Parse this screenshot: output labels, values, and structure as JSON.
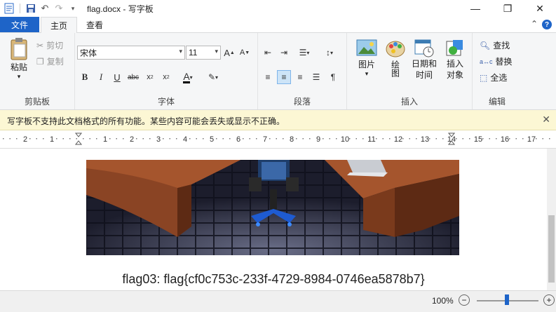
{
  "window": {
    "title": "flag.docx - 写字板"
  },
  "tabs": {
    "file": "文件",
    "home": "主页",
    "view": "查看"
  },
  "clipboard": {
    "paste": "粘贴",
    "cut": "剪切",
    "copy": "复制",
    "label": "剪贴板"
  },
  "font": {
    "name": "宋体",
    "size": "11",
    "label": "字体"
  },
  "paragraph": {
    "label": "段落"
  },
  "insert": {
    "picture": "图片",
    "paint": "绘图",
    "datetime": "日期和时间",
    "object": "插入对象",
    "label": "插入"
  },
  "editing": {
    "find": "查找",
    "replace": "替换",
    "select_all": "全选",
    "label": "编辑"
  },
  "infobar": {
    "message": "写字板不支持此文档格式的所有功能。某些内容可能会丢失或显示不正确。"
  },
  "ruler": {
    "ticks": [
      "2",
      "1",
      "1",
      "2",
      "3",
      "4",
      "5",
      "6",
      "7",
      "8",
      "9",
      "10",
      "11",
      "12",
      "13",
      "14",
      "15",
      "16",
      "17"
    ]
  },
  "document": {
    "flag_text": "flag03: flag{cf0c753c-233f-4729-8984-0746ea5878b7}"
  },
  "status": {
    "zoom": "100%"
  },
  "icons": {
    "save": "save-icon",
    "undo": "undo-icon",
    "redo": "redo-icon",
    "minimize": "minimize-icon",
    "maximize": "maximize-icon",
    "close": "close-icon"
  }
}
